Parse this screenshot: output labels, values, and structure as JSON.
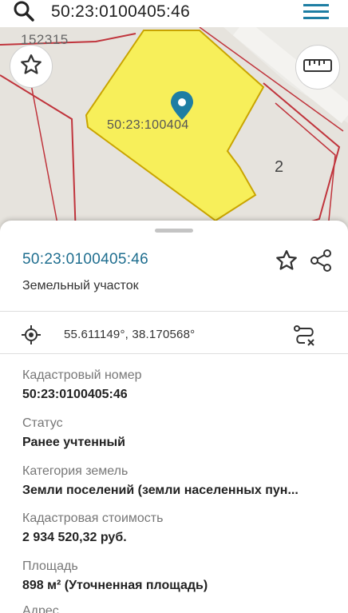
{
  "search": {
    "query": "50:23:0100405:46"
  },
  "map": {
    "top_number": "152315",
    "parcel_label": "50:23:100404",
    "number_label": "2",
    "colors": {
      "parcel_fill": "#f7ef5a",
      "parcel_border": "#c9a400",
      "boundary": "#c0343c",
      "marker": "#1e7ea3"
    }
  },
  "sheet": {
    "parcel_id": "50:23:0100405:46",
    "parcel_type": "Земельный участок",
    "coordinates": "55.611149°, 38.170568°",
    "fields": [
      {
        "label": "Кадастровый номер",
        "value": "50:23:0100405:46"
      },
      {
        "label": "Статус",
        "value": "Ранее учтенный"
      },
      {
        "label": "Категория земель",
        "value": "Земли поселений (земли населенных пун..."
      },
      {
        "label": "Кадастровая стоимость",
        "value": "2 934 520,32 руб."
      },
      {
        "label": "Площадь",
        "value": "898 м² (Уточненная площадь)"
      },
      {
        "label": "Адрес",
        "value": ""
      }
    ]
  },
  "icons": [
    "search-icon",
    "menu-icon",
    "star-icon",
    "ruler-icon",
    "location-pin-icon",
    "share-icon",
    "locate-icon",
    "route-icon"
  ]
}
